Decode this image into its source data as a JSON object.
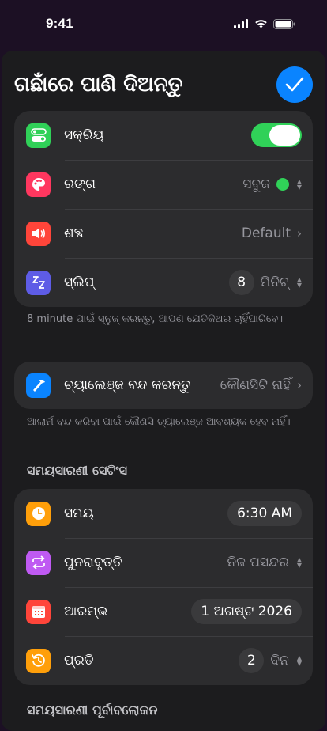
{
  "status_bar": {
    "time": "9:41"
  },
  "header": {
    "title": "ଗଛାଁରେ ପାଣି ଦିଅନ୍ତୁ",
    "confirm_icon": "checkmark-icon"
  },
  "alarm_group": {
    "rows": [
      {
        "label": "ସକ୍ରିୟ",
        "icon": "toggle-icon",
        "icon_color": "#30d158",
        "enabled": true
      },
      {
        "label": "ରଙ୍ଗ",
        "icon": "palette-icon",
        "icon_color": "#ff375f",
        "value": "ସବୁଜ",
        "swatch_color": "#30d158"
      },
      {
        "label": "ଶବ୍ଦ",
        "icon": "speaker-icon",
        "icon_color": "#ff453a",
        "value": "Default"
      },
      {
        "label": "ସ୍ଲିପ୍",
        "icon": "snooze-icon",
        "icon_color": "#5e5ce6",
        "number": "8",
        "unit": "ମିନିଟ୍"
      }
    ],
    "footnote": "8 minute ପାଇଁ ସ୍ନୁଜ୍ କରନ୍ତୁ, ଆପଣ ଯେତିକିଥର ଚାହିଁପାରିବେ।"
  },
  "challenge_group": {
    "label": "ଚ୍ୟାଲେଞ୍ଜ ବନ୍ଦ କରନ୍ତୁ",
    "value": "କୌଣସିଟି ନାହିଁ",
    "icon": "hammer-icon",
    "icon_color": "#0a84ff",
    "footnote": "ଆଲାର୍ମ ବନ୍ଦ କରିବା ପାଇଁ କୌଣସି ଚ୍ୟାଲେଞ୍ଜ ଆବଶ୍ୟକ ହେବ ନାହିଁ।"
  },
  "schedule": {
    "section_title": "ସମୟସାରଣୀ ସେଟିଂସ",
    "rows": [
      {
        "label": "ସମୟ",
        "icon": "clock-icon",
        "icon_color": "#ff9f0a",
        "value": "6:30 AM"
      },
      {
        "label": "ପୁନରାବୃତ୍ତି",
        "icon": "repeat-icon",
        "icon_color": "#bf5af2",
        "value": "ନିଜ ପସନ୍ଦର"
      },
      {
        "label": "ଆରମ୍ଭ",
        "icon": "calendar-icon",
        "icon_color": "#ff453a",
        "value": "1 ଅଗଷ୍ଟ 2026"
      },
      {
        "label": "ପ୍ରତି",
        "icon": "history-icon",
        "icon_color": "#ff9f0a",
        "number": "2",
        "unit": "ଦିନ"
      }
    ]
  },
  "next_section_title": "ସମୟସାରଣୀ ପୂର୍ବାବଲୋକନ"
}
